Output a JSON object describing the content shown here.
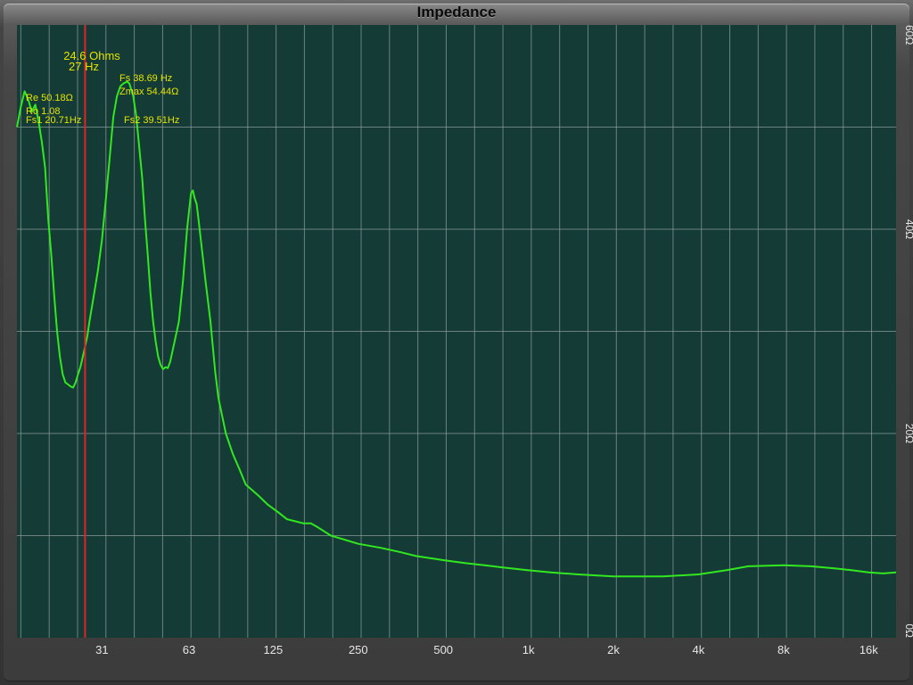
{
  "window": {
    "title": "Impedance"
  },
  "colors": {
    "plot_background": "#153b36",
    "grid": "#8a9a97",
    "trace": "#31e81f",
    "cursor": "#e0222a",
    "annotation": "#e3e300",
    "frame": "#3c3c3c"
  },
  "chart_data": {
    "type": "line",
    "title": "Impedance",
    "xscale": "log",
    "xlim": [
      15.5,
      20000
    ],
    "ylim": [
      0,
      60
    ],
    "grid": true,
    "x_ticks": [
      {
        "value": 31,
        "label": "31"
      },
      {
        "value": 63,
        "label": "63"
      },
      {
        "value": 125,
        "label": "125"
      },
      {
        "value": 250,
        "label": "250"
      },
      {
        "value": 500,
        "label": "500"
      },
      {
        "value": 1000,
        "label": "1k"
      },
      {
        "value": 2000,
        "label": "2k"
      },
      {
        "value": 4000,
        "label": "4k"
      },
      {
        "value": 8000,
        "label": "8k"
      },
      {
        "value": 16000,
        "label": "16k"
      }
    ],
    "y_ticks": [
      {
        "value": 0,
        "label": "0Ω"
      },
      {
        "value": 20,
        "label": "20Ω"
      },
      {
        "value": 40,
        "label": "40Ω"
      },
      {
        "value": 60,
        "label": "60Ω"
      }
    ],
    "y_minor_step": 10,
    "series": [
      {
        "x": [
          15.5,
          16.0,
          16.5,
          17.0,
          17.5,
          18.0,
          18.5,
          19.0,
          19.5,
          20.0,
          20.5,
          21.0,
          21.5,
          22.0,
          22.5,
          23.0,
          23.5,
          24.0,
          24.5,
          25.0,
          25.5,
          26.0,
          26.5,
          27.0,
          27.5,
          28.0,
          29.0,
          30.0,
          31.0,
          32.0,
          33.0,
          34.0,
          35.0,
          36.0,
          37.0,
          38.0,
          38.7,
          39.5,
          40.0,
          41.0,
          42.0,
          43.0,
          44.0,
          45.0,
          46.0,
          47.0,
          48.0,
          49.0,
          50.0,
          51.0,
          52.0,
          53.0,
          54.0,
          55.0,
          56.0,
          57.0,
          58.0,
          60.0,
          62.0,
          64.0,
          65.0,
          66.0,
          67.0,
          68.0,
          70.0,
          72.0,
          75.0,
          78.0,
          80.0,
          85.0,
          90.0,
          95.0,
          100.0,
          110.0,
          120.0,
          130.0,
          140.0,
          150.0,
          160.0,
          170.0,
          180.0,
          200.0,
          250.0,
          300.0,
          350.0,
          400.0,
          500.0,
          600.0,
          700.0,
          800.0,
          1000.0,
          1200.0,
          1500.0,
          2000.0,
          2500.0,
          3000.0,
          4000.0,
          5000.0,
          6000.0,
          8000.0,
          10000.0,
          12000.0,
          14000.0,
          16000.0,
          18000.0,
          20000.0
        ],
        "y": [
          50.0,
          52.0,
          53.5,
          52.7,
          51.5,
          52.2,
          50.5,
          48.5,
          46.0,
          41.0,
          37.5,
          33.5,
          30.0,
          27.5,
          25.8,
          25.0,
          24.8,
          24.6,
          24.5,
          25.0,
          25.8,
          26.5,
          27.5,
          28.5,
          29.5,
          31.0,
          33.5,
          36.0,
          39.0,
          43.0,
          47.0,
          51.0,
          53.0,
          54.0,
          54.3,
          54.44,
          54.3,
          53.5,
          53.0,
          51.0,
          48.0,
          45.0,
          41.0,
          37.5,
          33.8,
          31.0,
          29.0,
          27.5,
          26.7,
          26.3,
          26.5,
          26.4,
          27.0,
          28.0,
          29.0,
          30.0,
          31.0,
          35.0,
          40.0,
          43.5,
          43.8,
          43.0,
          42.5,
          41.0,
          38.0,
          35.0,
          31.0,
          26.0,
          23.5,
          20.0,
          18.0,
          16.5,
          15.0,
          14.0,
          13.0,
          12.3,
          11.6,
          11.4,
          11.2,
          11.2,
          10.8,
          10.0,
          9.2,
          8.8,
          8.4,
          8.0,
          7.6,
          7.3,
          7.1,
          6.9,
          6.6,
          6.4,
          6.2,
          6.0,
          6.0,
          6.0,
          6.2,
          6.6,
          7.0,
          7.1,
          7.0,
          6.8,
          6.6,
          6.4,
          6.3,
          6.4
        ]
      }
    ],
    "cursor": {
      "freq_hz": 27,
      "value_label": "24.6 Ohms",
      "freq_label": "27 Hz"
    },
    "annotations": {
      "re": "Re 50.18Ω",
      "ro": "Ro 1.08",
      "fs1": "Fs1 20.71Hz",
      "fs": "Fs 38.69 Hz",
      "zmax": "Zmax 54.44Ω",
      "fs2": "Fs2 39.51Hz"
    }
  }
}
